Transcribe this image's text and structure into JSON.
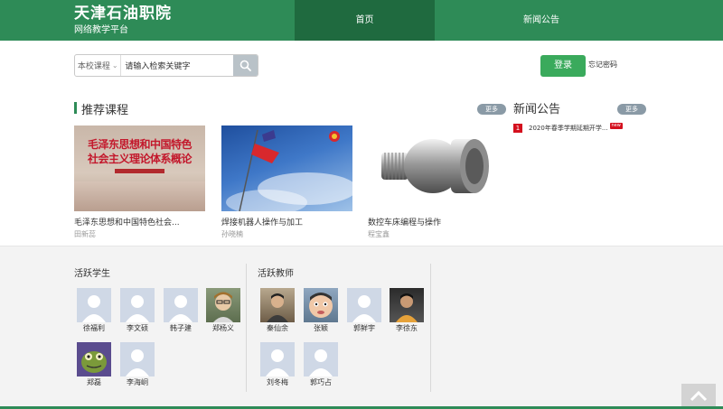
{
  "header": {
    "site_name": "天津石油职院",
    "site_sub": "网络教学平台",
    "nav": [
      {
        "label": "首页"
      },
      {
        "label": "新闻公告"
      }
    ]
  },
  "search": {
    "scope_label": "本校课程",
    "input_value": "请输入检索关键字"
  },
  "auth": {
    "login_label": "登录",
    "forgot_label": "忘记密码"
  },
  "courses": {
    "title": "推荐课程",
    "more_label": "更多",
    "items": [
      {
        "title": "毛泽东思想和中国特色社会...",
        "teacher": "田新蕊",
        "thumb_text_1": "毛泽东思想和中国特色",
        "thumb_text_2": "社会主义理论体系概论"
      },
      {
        "title": "焊接机器人操作与加工",
        "teacher": "孙晓楠"
      },
      {
        "title": "数控车床编程与操作",
        "teacher": "程宝鑫"
      }
    ]
  },
  "news": {
    "title": "新闻公告",
    "more_label": "更多",
    "items": [
      {
        "index": "1",
        "text": "2020年春季学期延期开学...",
        "badge": "new"
      }
    ]
  },
  "students": {
    "title": "活跃学生",
    "items": [
      {
        "name": "徐福利",
        "avatar": "default"
      },
      {
        "name": "李文硕",
        "avatar": "default"
      },
      {
        "name": "韩子建",
        "avatar": "default"
      },
      {
        "name": "郑杨义",
        "avatar": "photo"
      },
      {
        "name": "郑磊",
        "avatar": "photo"
      },
      {
        "name": "李海峒",
        "avatar": "default"
      }
    ]
  },
  "teachers": {
    "title": "活跃教师",
    "items": [
      {
        "name": "秦仙余",
        "avatar": "photo"
      },
      {
        "name": "张颖",
        "avatar": "photo"
      },
      {
        "name": "郭鲜宇",
        "avatar": "default"
      },
      {
        "name": "李徐东",
        "avatar": "photo"
      },
      {
        "name": "刘冬梅",
        "avatar": "default"
      },
      {
        "name": "郭巧占",
        "avatar": "default"
      }
    ]
  },
  "colors": {
    "header_green": "#2e8b57",
    "nav_active": "#1f6a3f",
    "login_green": "#3aaa5c",
    "news_red": "#d4101e"
  },
  "icons": {
    "search": "search-icon",
    "chevron": "chevron-down-icon",
    "back_to_top": "chevron-up-icon"
  }
}
